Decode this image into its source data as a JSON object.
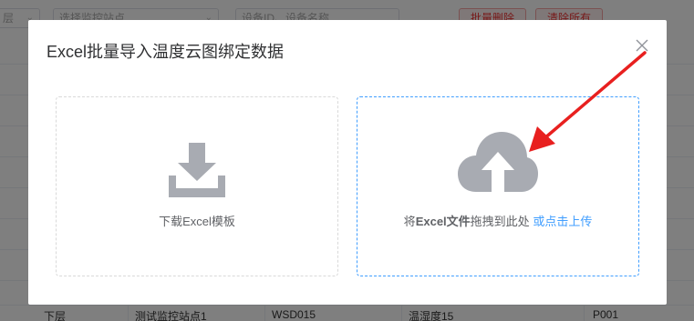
{
  "background": {
    "floor_select": "层",
    "station_select_placeholder": "选择监控站点",
    "search_placeholder": "设备ID、设备名称",
    "batch_delete_label": "批量删除",
    "clear_all_label": "清除所有",
    "row": {
      "floor": "下层",
      "station": "测试监控站点1",
      "device_id": "WSD015",
      "device_name": "温湿度15",
      "code": "P001"
    }
  },
  "modal": {
    "title": "Excel批量导入温度云图绑定数据",
    "close_icon": "close-icon",
    "download_card": {
      "icon": "download-icon",
      "label": "下载Excel模板"
    },
    "upload_card": {
      "icon": "cloud-upload-icon",
      "label_prefix": "将",
      "label_bold": "Excel文件",
      "label_middle": "拖拽到此处",
      "link_text": "或点击上传"
    }
  },
  "annotation": {
    "arrow_color": "#e8201f"
  },
  "colors": {
    "accent": "#409eff",
    "icon_gray": "#a8abb2",
    "danger": "#ee3333"
  }
}
